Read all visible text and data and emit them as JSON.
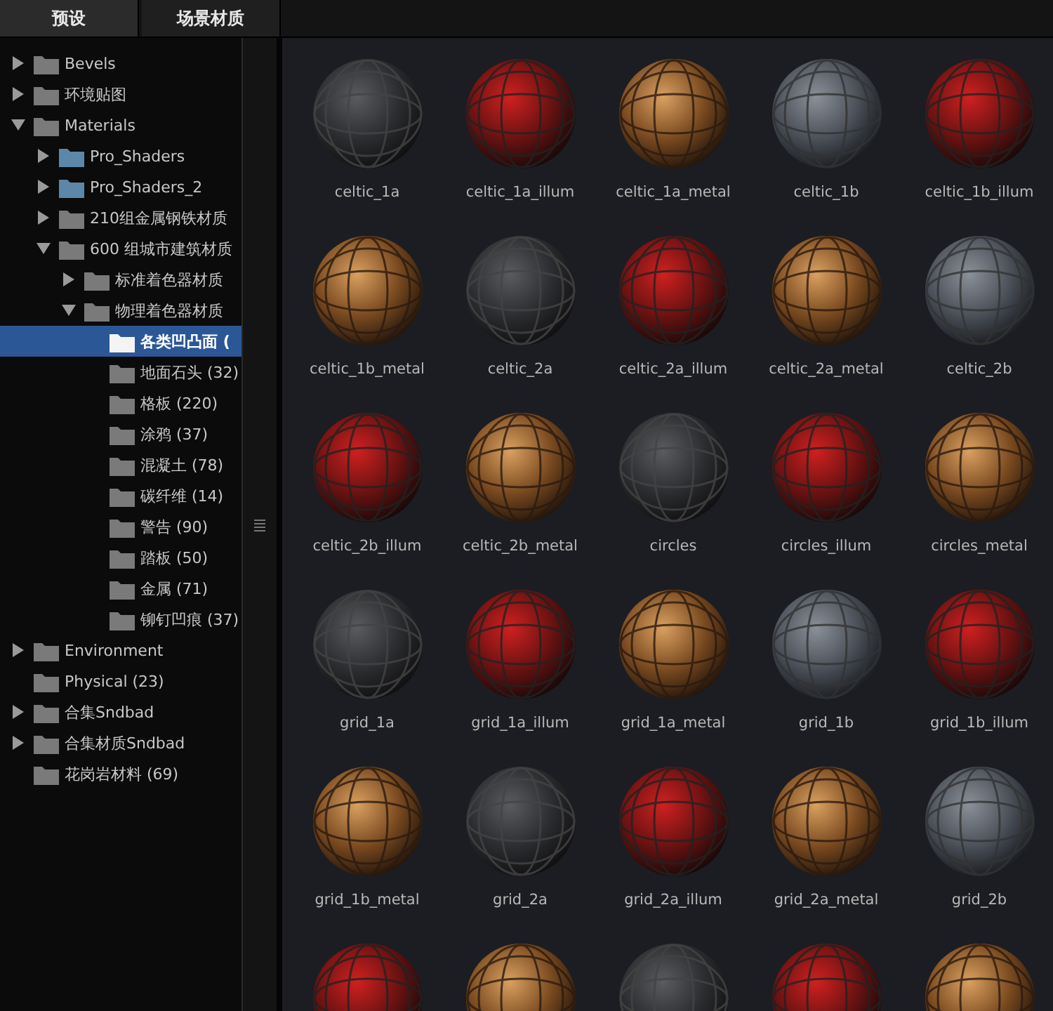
{
  "tabs": [
    {
      "label": "预设",
      "selected": true
    },
    {
      "label": "场景材质",
      "selected": false
    }
  ],
  "tree": [
    {
      "label": "Bevels",
      "expanded": false,
      "selected": false,
      "color": "#7a7a7a"
    },
    {
      "label": "环境贴图",
      "expanded": false,
      "selected": false,
      "color": "#7a7a7a"
    },
    {
      "label": "Materials",
      "expanded": true,
      "selected": false,
      "color": "#7a7a7a",
      "children": [
        {
          "label": "Pro_Shaders",
          "expanded": false,
          "selected": false,
          "color": "#5d87a8"
        },
        {
          "label": "Pro_Shaders_2",
          "expanded": false,
          "selected": false,
          "color": "#5d87a8"
        },
        {
          "label": "210组金属钢铁材质",
          "expanded": false,
          "selected": false,
          "color": "#7a7a7a"
        },
        {
          "label": "600 组城市建筑材质",
          "expanded": true,
          "selected": false,
          "color": "#7a7a7a",
          "children": [
            {
              "label": "标准着色器材质",
              "expanded": false,
              "selected": false,
              "color": "#7a7a7a"
            },
            {
              "label": "物理着色器材质",
              "expanded": true,
              "selected": false,
              "color": "#7a7a7a",
              "children": [
                {
                  "label": "各类凹凸面 (",
                  "selected": true
                },
                {
                  "label": "地面石头 (32)",
                  "selected": false,
                  "color": "#7a7a7a"
                },
                {
                  "label": "格板 (220)",
                  "selected": false,
                  "color": "#7a7a7a"
                },
                {
                  "label": "涂鸦 (37)",
                  "selected": false,
                  "color": "#7a7a7a"
                },
                {
                  "label": "混凝土 (78)",
                  "selected": false,
                  "color": "#7a7a7a"
                },
                {
                  "label": "碳纤维 (14)",
                  "selected": false,
                  "color": "#7a7a7a"
                },
                {
                  "label": "警告 (90)",
                  "selected": false,
                  "color": "#7a7a7a"
                },
                {
                  "label": "踏板 (50)",
                  "selected": false,
                  "color": "#7a7a7a"
                },
                {
                  "label": "金属 (71)",
                  "selected": false,
                  "color": "#7a7a7a"
                },
                {
                  "label": "铆钉凹痕 (37)",
                  "selected": false,
                  "color": "#7a7a7a"
                }
              ]
            }
          ]
        }
      ]
    },
    {
      "label": "Environment",
      "expanded": false,
      "selected": false,
      "color": "#7a7a7a"
    },
    {
      "label": "Physical (23)",
      "selected": false,
      "color": "#7a7a7a"
    },
    {
      "label": "合集Sndbad",
      "expanded": false,
      "selected": false,
      "color": "#7a7a7a"
    },
    {
      "label": "合集材质Sndbad",
      "expanded": false,
      "selected": false,
      "color": "#7a7a7a"
    },
    {
      "label": "花岗岩材料 (69)",
      "selected": false,
      "color": "#7a7a7a"
    }
  ],
  "materials": [
    {
      "name": "celtic_1a",
      "kind": "dark"
    },
    {
      "name": "celtic_1a_illum",
      "kind": "red"
    },
    {
      "name": "celtic_1a_metal",
      "kind": "copper"
    },
    {
      "name": "celtic_1b",
      "kind": "steel"
    },
    {
      "name": "celtic_1b_illum",
      "kind": "red"
    },
    {
      "name": "celtic_1b_metal",
      "kind": "copper"
    },
    {
      "name": "celtic_2a",
      "kind": "dark"
    },
    {
      "name": "celtic_2a_illum",
      "kind": "red"
    },
    {
      "name": "celtic_2a_metal",
      "kind": "copper"
    },
    {
      "name": "celtic_2b",
      "kind": "steel"
    },
    {
      "name": "celtic_2b_illum",
      "kind": "red"
    },
    {
      "name": "celtic_2b_metal",
      "kind": "copper"
    },
    {
      "name": "circles",
      "kind": "dark"
    },
    {
      "name": "circles_illum",
      "kind": "red"
    },
    {
      "name": "circles_metal",
      "kind": "copper"
    },
    {
      "name": "grid_1a",
      "kind": "dark"
    },
    {
      "name": "grid_1a_illum",
      "kind": "red"
    },
    {
      "name": "grid_1a_metal",
      "kind": "copper"
    },
    {
      "name": "grid_1b",
      "kind": "steel"
    },
    {
      "name": "grid_1b_illum",
      "kind": "red"
    },
    {
      "name": "grid_1b_metal",
      "kind": "copper"
    },
    {
      "name": "grid_2a",
      "kind": "dark"
    },
    {
      "name": "grid_2a_illum",
      "kind": "red"
    },
    {
      "name": "grid_2a_metal",
      "kind": "copper"
    },
    {
      "name": "grid_2b",
      "kind": "steel"
    },
    {
      "kind": "red"
    },
    {
      "kind": "copper"
    },
    {
      "kind": "dark"
    },
    {
      "kind": "red"
    },
    {
      "kind": "copper"
    }
  ]
}
